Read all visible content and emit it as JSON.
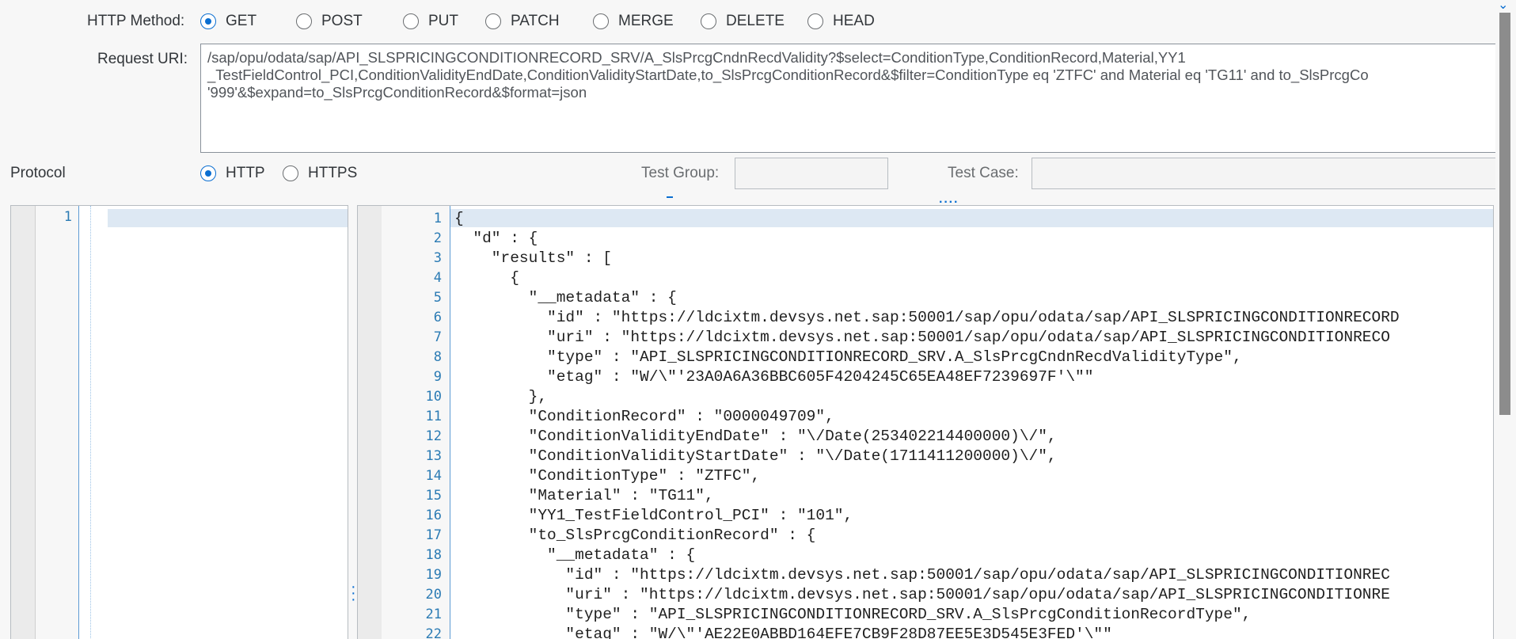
{
  "method": {
    "label": "HTTP Method:",
    "options": [
      {
        "label": "GET",
        "checked": true
      },
      {
        "label": "POST",
        "checked": false
      },
      {
        "label": "PUT",
        "checked": false
      },
      {
        "label": "PATCH",
        "checked": false
      },
      {
        "label": "MERGE",
        "checked": false
      },
      {
        "label": "DELETE",
        "checked": false
      },
      {
        "label": "HEAD",
        "checked": false
      }
    ]
  },
  "uri": {
    "label": "Request URI:",
    "value": "/sap/opu/odata/sap/API_SLSPRICINGCONDITIONRECORD_SRV/A_SlsPrcgCndnRecdValidity?$select=ConditionType,ConditionRecord,Material,YY1\n_TestFieldControl_PCI,ConditionValidityEndDate,ConditionValidityStartDate,to_SlsPrcgConditionRecord&$filter=ConditionType eq 'ZTFC' and Material eq 'TG11' and to_SlsPrcgCo\n'999'&$expand=to_SlsPrcgConditionRecord&$format=json"
  },
  "protocol": {
    "label": "Protocol",
    "options": [
      {
        "label": "HTTP",
        "checked": true
      },
      {
        "label": "HTTPS",
        "checked": false
      }
    ]
  },
  "test_group": {
    "label": "Test Group:",
    "value": ""
  },
  "test_case": {
    "label": "Test Case:",
    "value": ""
  },
  "request_editor": {
    "lines": [
      "1"
    ]
  },
  "response_editor": {
    "lines": [
      "{",
      "  \"d\" : {",
      "    \"results\" : [",
      "      {",
      "        \"__metadata\" : {",
      "          \"id\" : \"https://ldcixtm.devsys.net.sap:50001/sap/opu/odata/sap/API_SLSPRICINGCONDITIONRECORD",
      "          \"uri\" : \"https://ldcixtm.devsys.net.sap:50001/sap/opu/odata/sap/API_SLSPRICINGCONDITIONRECO",
      "          \"type\" : \"API_SLSPRICINGCONDITIONRECORD_SRV.A_SlsPrcgCndnRecdValidityType\",",
      "          \"etag\" : \"W/\\\"'23A0A6A36BBC605F4204245C65EA48EF7239697F'\\\"\"",
      "        },",
      "        \"ConditionRecord\" : \"0000049709\",",
      "        \"ConditionValidityEndDate\" : \"\\/Date(253402214400000)\\/\",",
      "        \"ConditionValidityStartDate\" : \"\\/Date(1711411200000)\\/\",",
      "        \"ConditionType\" : \"ZTFC\",",
      "        \"Material\" : \"TG11\",",
      "        \"YY1_TestFieldControl_PCI\" : \"101\",",
      "        \"to_SlsPrcgConditionRecord\" : {",
      "          \"__metadata\" : {",
      "            \"id\" : \"https://ldcixtm.devsys.net.sap:50001/sap/opu/odata/sap/API_SLSPRICINGCONDITIONREC",
      "            \"uri\" : \"https://ldcixtm.devsys.net.sap:50001/sap/opu/odata/sap/API_SLSPRICINGCONDITIONRE",
      "            \"type\" : \"API_SLSPRICINGCONDITIONRECORD_SRV.A_SlsPrcgConditionRecordType\",",
      "            \"etag\" : \"W/\\\"'AE22E0ABBD164EFE7CB9F28D87EE5E3D545E3FED'\\\"\""
    ]
  }
}
